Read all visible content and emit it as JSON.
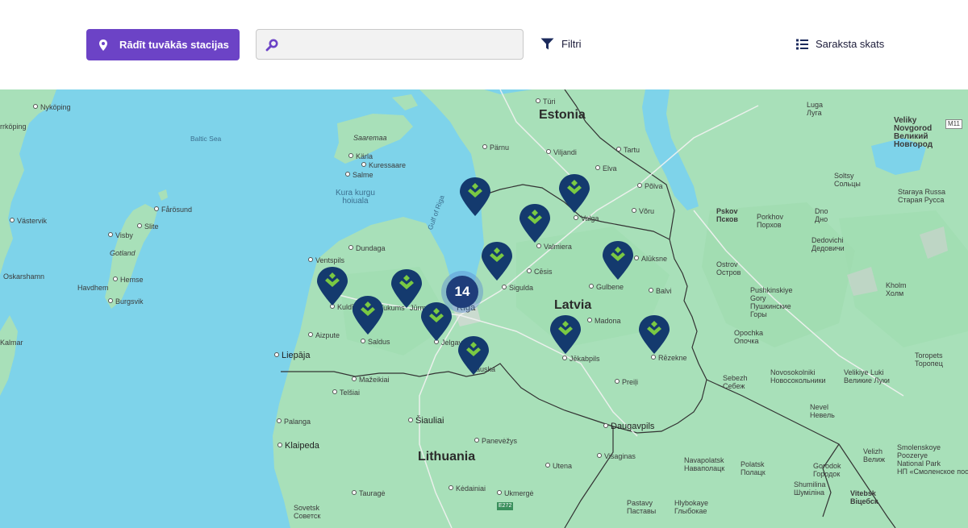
{
  "toolbar": {
    "nearest_label": "Rādīt tuvākās stacijas",
    "search_value": "",
    "search_placeholder": "",
    "filters_label": "Filtri",
    "list_label": "Saraksta skats",
    "accent_color": "#6c43c6"
  },
  "map": {
    "countries": [
      "Estonia",
      "Latvia",
      "Lithuania"
    ],
    "waters": [
      "Baltic Sea",
      "Gulf of Riga",
      "Kura kurgu\nhoiuala"
    ],
    "places": [
      "Nyköping",
      "rrköping",
      "Saaremaa",
      "Kärla",
      "Kuressaare",
      "Salme",
      "Fårösund",
      "Västervik",
      "Visby",
      "Slite",
      "Gotland",
      "Hemse",
      "Havdhem",
      "Burgsvik",
      "Oskarshamn",
      "Kalmar",
      "Dundaga",
      "Ventspils",
      "Kuldīga",
      "Tukums",
      "Jūrmala",
      "Rīga",
      "Jelgava",
      "Bauska",
      "Saldus",
      "Aizpute",
      "Liepāja",
      "Mažeikiai",
      "Telšiai",
      "Šiauliai",
      "Palanga",
      "Klaipeda",
      "Panevėžys",
      "Utena",
      "Kėdainiai",
      "Ukmergė",
      "Tauragė",
      "Sovetsk\nСоветск",
      "Türi",
      "Pärnu",
      "Viljandi",
      "Tartu",
      "Elva",
      "Põlva",
      "Võru",
      "Valga",
      "Valmiera",
      "Cēsis",
      "Sigulda",
      "Alūksne",
      "Gulbene",
      "Balvi",
      "Madona",
      "Jēkabpils",
      "Rēzekne",
      "Preiļi",
      "Daugavpils",
      "Visaginas",
      "Luga\nЛуга",
      "Veliky\nNovgorod\nВеликий\nНовгород",
      "Soltsy\nСольцы",
      "Staraya Russa\nСтарая Русса",
      "Pskov\nПсков",
      "Porkhov\nПорхов",
      "Dno\nДно",
      "Dedovichi\nДедовичи",
      "Ostrov\nОстров",
      "Pushkinskiye\nGory\nПушкинские\nГоры",
      "Kholm\nХолм",
      "Opochka\nОпочка",
      "Toropets\nТоропец",
      "Sebezh\nСебеж",
      "Novosokolniki\nНовосокольники",
      "Velikiye Luki\nВеликие Луки",
      "Nevel\nНевель",
      "Velizh\nВелиж",
      "Smolenskoye\nPoozerye\nNational Park\nНП «Смоленское поозерье»",
      "Navapolatsk\nНаваполацк",
      "Polatsk\nПолацк",
      "Gorodok\nГородок",
      "Shumilina\nШуміліна",
      "Vitebsk\nВіцебск",
      "Pastavy\nПаставы",
      "Hlybokaye\nГлыбокае"
    ],
    "route_badges": [
      "M11",
      "E272"
    ],
    "cluster_count": "14",
    "stations_shown": 13
  }
}
